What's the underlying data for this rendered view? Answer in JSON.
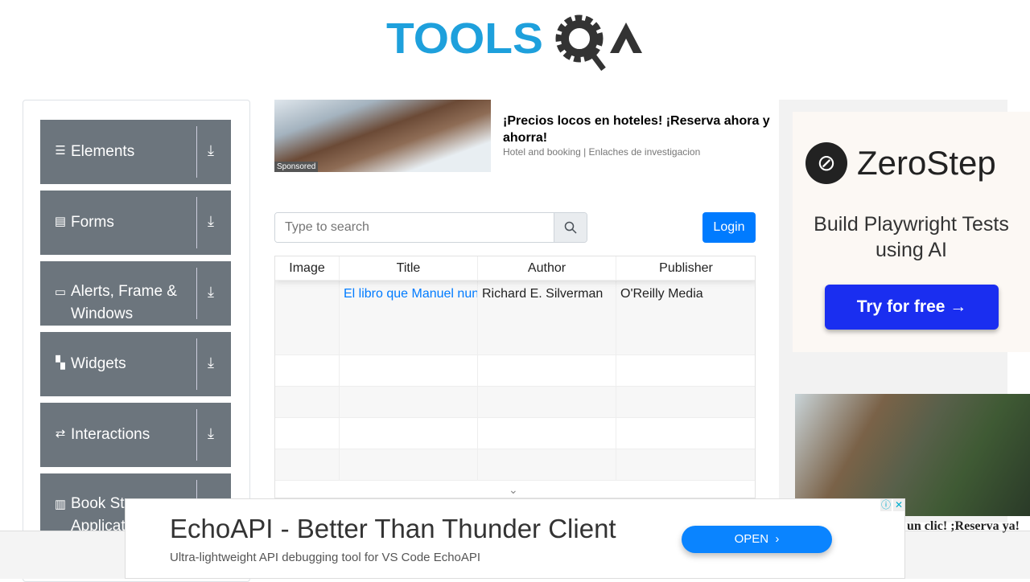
{
  "logo": {
    "text_blue": "TOOLS",
    "text_dark": "QA",
    "color_blue": "#1ea0dc",
    "color_dark": "#333333"
  },
  "sidebar": {
    "groups": [
      {
        "label": "Elements",
        "icon": "hamburger-icon",
        "glyph": "☰"
      },
      {
        "label": "Forms",
        "icon": "document-icon",
        "glyph": "▤"
      },
      {
        "label": "Alerts, Frame & Windows",
        "icon": "window-icon",
        "glyph": "▭"
      },
      {
        "label": "Widgets",
        "icon": "widgets-icon",
        "glyph": "▚"
      },
      {
        "label": "Interactions",
        "icon": "interactions-icon",
        "glyph": "⇄"
      },
      {
        "label": "Book Store Application",
        "icon": "books-icon",
        "glyph": "𝍫"
      }
    ],
    "download_glyph": "⤓"
  },
  "top_ad": {
    "headline": "¡Precios locos en hoteles! ¡Reserva ahora y ahorra!",
    "source": "Hotel and booking | Enlaches de investigacion",
    "badge": "Sponsored"
  },
  "search": {
    "placeholder": "Type to search",
    "value": ""
  },
  "login": {
    "label": "Login"
  },
  "table": {
    "headers": [
      "Image",
      "Title",
      "Author",
      "Publisher"
    ],
    "rows": [
      {
        "image": "",
        "title": "El libro que Manuel nunca escribió",
        "author": "Richard E. Silverman",
        "publisher": "O'Reilly Media"
      }
    ],
    "empty_rows": 5
  },
  "right_ad": {
    "brand": "ZeroStep",
    "tagline": "Build Playwright Tests using AI",
    "cta": "Try for free →",
    "caption": "un clic! ;Reserva ya!"
  },
  "bottom_ad": {
    "headline": "EchoAPI - Better Than Thunder Client",
    "subline": "Ultra-lightweight API debugging tool for VS Code EchoAPI",
    "cta": "OPEN",
    "info": "ⓘ",
    "close": "✕"
  },
  "colors": {
    "sidebar_bg": "#6c757d",
    "primary": "#007bff",
    "link": "#007bff"
  }
}
